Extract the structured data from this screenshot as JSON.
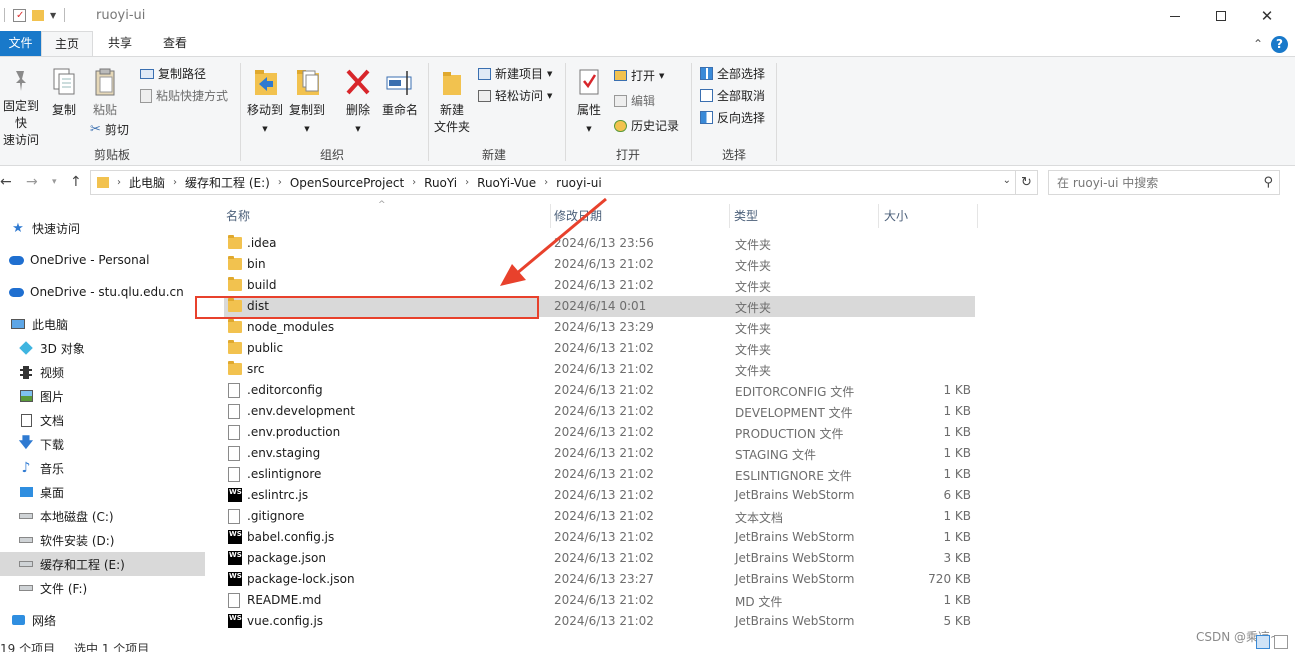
{
  "window": {
    "title": "ruoyi-ui",
    "minimize_icon": "minimize-icon",
    "maximize_icon": "maximize-icon",
    "close_icon": "close-icon"
  },
  "ribbon_tabs": [
    {
      "label": "文件"
    },
    {
      "label": "主页"
    },
    {
      "label": "共享"
    },
    {
      "label": "查看"
    }
  ],
  "ribbon": {
    "clipboard": {
      "pin_label_1": "固定到快",
      "pin_label_2": "速访问",
      "copy_label": "复制",
      "paste_label": "粘贴",
      "copy_path_label": "复制路径",
      "paste_shortcut_label": "粘贴快捷方式",
      "cut_label": "剪切",
      "group_label": "剪贴板"
    },
    "organize": {
      "move_to_label": "移动到",
      "copy_to_label": "复制到",
      "delete_label": "删除",
      "rename_label": "重命名",
      "group_label": "组织"
    },
    "new": {
      "new_folder_label_1": "新建",
      "new_folder_label_2": "文件夹",
      "new_item_label": "新建项目",
      "easy_access_label": "轻松访问",
      "group_label": "新建"
    },
    "open": {
      "properties_label": "属性",
      "open_label": "打开",
      "edit_label": "编辑",
      "history_label": "历史记录",
      "group_label": "打开"
    },
    "select": {
      "select_all_label": "全部选择",
      "select_none_label": "全部取消",
      "invert_label": "反向选择",
      "group_label": "选择"
    }
  },
  "address": {
    "crumbs": [
      "此电脑",
      "缓存和工程 (E:)",
      "OpenSourceProject",
      "RuoYi",
      "RuoYi-Vue",
      "ruoyi-ui"
    ],
    "search_placeholder": "在 ruoyi-ui 中搜索"
  },
  "nav_pane": {
    "items": [
      {
        "label": "快速访问",
        "icon": "star-icon"
      },
      {
        "label": "OneDrive - Personal",
        "icon": "cloud-icon"
      },
      {
        "label": "OneDrive - stu.qlu.edu.cn",
        "icon": "cloud-icon"
      },
      {
        "label": "此电脑",
        "icon": "computer-icon"
      },
      {
        "label": "3D 对象",
        "icon": "cube-icon"
      },
      {
        "label": "视频",
        "icon": "video-icon"
      },
      {
        "label": "图片",
        "icon": "picture-icon"
      },
      {
        "label": "文档",
        "icon": "document-icon"
      },
      {
        "label": "下载",
        "icon": "download-icon"
      },
      {
        "label": "音乐",
        "icon": "music-icon"
      },
      {
        "label": "桌面",
        "icon": "desktop-icon"
      },
      {
        "label": "本地磁盘 (C:)",
        "icon": "drive-icon"
      },
      {
        "label": "软件安装 (D:)",
        "icon": "drive-icon"
      },
      {
        "label": "缓存和工程 (E:)",
        "icon": "drive-icon"
      },
      {
        "label": "文件 (F:)",
        "icon": "drive-icon"
      },
      {
        "label": "网络",
        "icon": "network-icon"
      }
    ]
  },
  "columns": {
    "name": "名称",
    "date": "修改日期",
    "type": "类型",
    "size": "大小"
  },
  "files": [
    {
      "name": ".idea",
      "date": "2024/6/13 23:56",
      "type": "文件夹",
      "size": "",
      "icon": "folder-icon"
    },
    {
      "name": "bin",
      "date": "2024/6/13 21:02",
      "type": "文件夹",
      "size": "",
      "icon": "folder-icon"
    },
    {
      "name": "build",
      "date": "2024/6/13 21:02",
      "type": "文件夹",
      "size": "",
      "icon": "folder-icon"
    },
    {
      "name": "dist",
      "date": "2024/6/14 0:01",
      "type": "文件夹",
      "size": "",
      "icon": "folder-icon"
    },
    {
      "name": "node_modules",
      "date": "2024/6/13 23:29",
      "type": "文件夹",
      "size": "",
      "icon": "folder-icon"
    },
    {
      "name": "public",
      "date": "2024/6/13 21:02",
      "type": "文件夹",
      "size": "",
      "icon": "folder-icon"
    },
    {
      "name": "src",
      "date": "2024/6/13 21:02",
      "type": "文件夹",
      "size": "",
      "icon": "folder-icon"
    },
    {
      "name": ".editorconfig",
      "date": "2024/6/13 21:02",
      "type": "EDITORCONFIG 文件",
      "size": "1 KB",
      "icon": "file-icon"
    },
    {
      "name": ".env.development",
      "date": "2024/6/13 21:02",
      "type": "DEVELOPMENT 文件",
      "size": "1 KB",
      "icon": "file-icon"
    },
    {
      "name": ".env.production",
      "date": "2024/6/13 21:02",
      "type": "PRODUCTION 文件",
      "size": "1 KB",
      "icon": "file-icon"
    },
    {
      "name": ".env.staging",
      "date": "2024/6/13 21:02",
      "type": "STAGING 文件",
      "size": "1 KB",
      "icon": "file-icon"
    },
    {
      "name": ".eslintignore",
      "date": "2024/6/13 21:02",
      "type": "ESLINTIGNORE 文件",
      "size": "1 KB",
      "icon": "file-icon"
    },
    {
      "name": ".eslintrc.js",
      "date": "2024/6/13 21:02",
      "type": "JetBrains WebStorm",
      "size": "6 KB",
      "icon": "webstorm-icon"
    },
    {
      "name": ".gitignore",
      "date": "2024/6/13 21:02",
      "type": "文本文档",
      "size": "1 KB",
      "icon": "file-icon"
    },
    {
      "name": "babel.config.js",
      "date": "2024/6/13 21:02",
      "type": "JetBrains WebStorm",
      "size": "1 KB",
      "icon": "webstorm-icon"
    },
    {
      "name": "package.json",
      "date": "2024/6/13 21:02",
      "type": "JetBrains WebStorm",
      "size": "3 KB",
      "icon": "webstorm-icon"
    },
    {
      "name": "package-lock.json",
      "date": "2024/6/13 23:27",
      "type": "JetBrains WebStorm",
      "size": "720 KB",
      "icon": "webstorm-icon"
    },
    {
      "name": "README.md",
      "date": "2024/6/13 21:02",
      "type": "MD 文件",
      "size": "1 KB",
      "icon": "file-icon"
    },
    {
      "name": "vue.config.js",
      "date": "2024/6/13 21:02",
      "type": "JetBrains WebStorm",
      "size": "5 KB",
      "icon": "webstorm-icon"
    }
  ],
  "selected_file": "dist",
  "status": {
    "item_count": "19 个项目",
    "selected": "选中 1 个项目"
  },
  "webstorm_badge": "WS",
  "watermark": "CSDN @乘凉~",
  "colors": {
    "accent": "#1979ca",
    "selection": "#d9d9d9",
    "annotation": "#e8412c"
  }
}
